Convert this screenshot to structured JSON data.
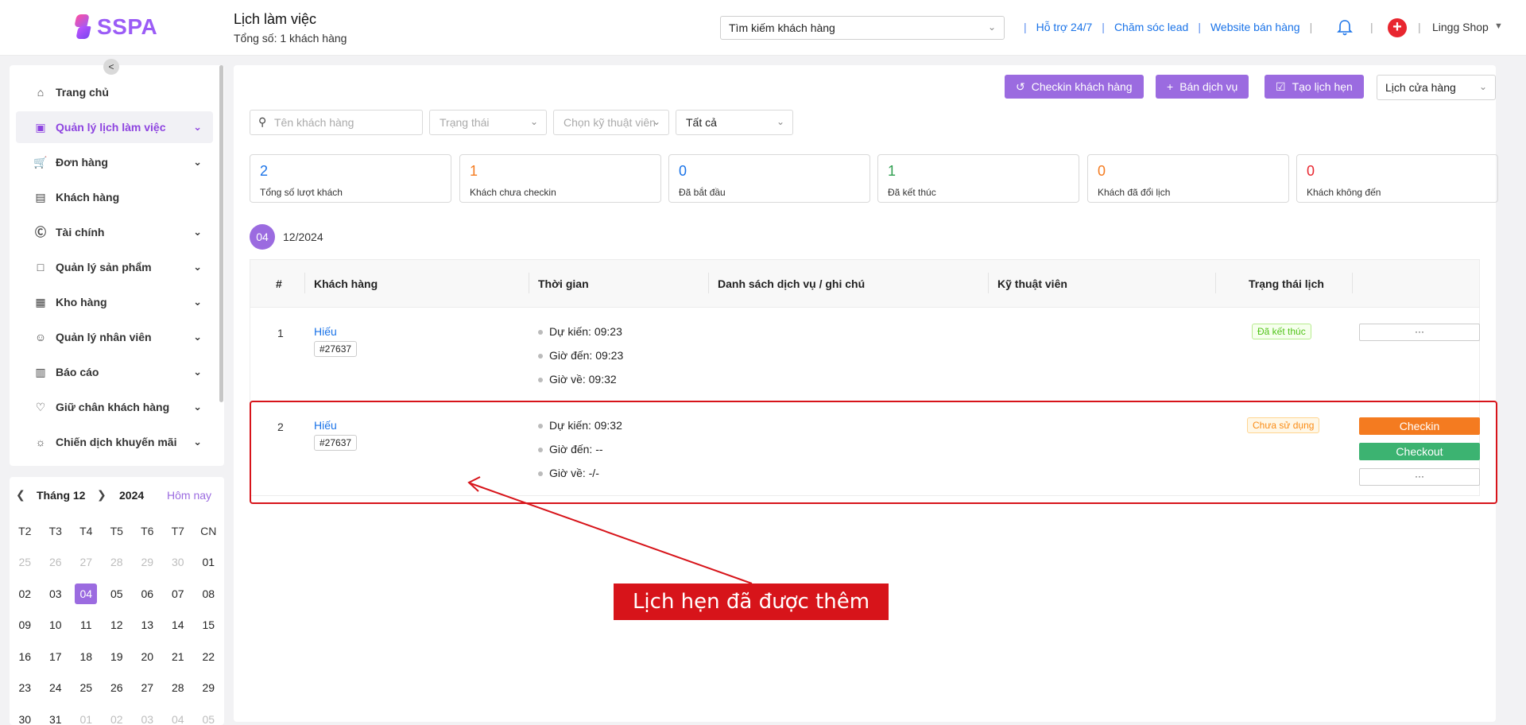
{
  "header": {
    "logo_text": "SSPA",
    "title": "Lịch làm việc",
    "subtitle": "Tổng số: 1 khách hàng",
    "search_placeholder": "Tìm kiếm khách hàng",
    "links": [
      "Hỗ trợ 24/7",
      "Chăm sóc lead",
      "Website bán hàng"
    ],
    "user_name": "Lingg Shop"
  },
  "sidebar": {
    "items": [
      {
        "label": "Trang chủ",
        "icon": "home-icon",
        "has_submenu": false
      },
      {
        "label": "Quản lý lịch làm việc",
        "icon": "calendar-icon",
        "has_submenu": true,
        "active": true
      },
      {
        "label": "Đơn hàng",
        "icon": "cart-icon",
        "has_submenu": true
      },
      {
        "label": "Khách hàng",
        "icon": "id-card-icon",
        "has_submenu": false
      },
      {
        "label": "Tài chính",
        "icon": "dollar-icon",
        "has_submenu": true
      },
      {
        "label": "Quản lý sản phẩm",
        "icon": "box-icon",
        "has_submenu": true
      },
      {
        "label": "Kho hàng",
        "icon": "warehouse-icon",
        "has_submenu": true
      },
      {
        "label": "Quản lý nhân viên",
        "icon": "users-icon",
        "has_submenu": true
      },
      {
        "label": "Báo cáo",
        "icon": "chart-icon",
        "has_submenu": true
      },
      {
        "label": "Giữ chân khách hàng",
        "icon": "heart-icon",
        "has_submenu": true
      },
      {
        "label": "Chiến dịch khuyến mãi",
        "icon": "promo-icon",
        "has_submenu": true
      }
    ]
  },
  "calendar": {
    "month_label": "Tháng 12",
    "year_label": "2024",
    "today_label": "Hôm nay",
    "weekdays": [
      "T2",
      "T3",
      "T4",
      "T5",
      "T6",
      "T7",
      "CN"
    ],
    "weeks": [
      [
        "25",
        "26",
        "27",
        "28",
        "29",
        "30",
        "01"
      ],
      [
        "02",
        "03",
        "04",
        "05",
        "06",
        "07",
        "08"
      ],
      [
        "09",
        "10",
        "11",
        "12",
        "13",
        "14",
        "15"
      ],
      [
        "16",
        "17",
        "18",
        "19",
        "20",
        "21",
        "22"
      ],
      [
        "23",
        "24",
        "25",
        "26",
        "27",
        "28",
        "29"
      ],
      [
        "30",
        "31",
        "01",
        "02",
        "03",
        "04",
        "05"
      ]
    ],
    "selected": "04"
  },
  "toolbar": {
    "checkin_customer": "Checkin khách hàng",
    "sell_service": "Bán dịch vụ",
    "create_appointment": "Tạo lịch hẹn",
    "store_select": "Lịch cửa hàng"
  },
  "filters": {
    "customer_placeholder": "Tên khách hàng",
    "status_placeholder": "Trạng thái",
    "technician_placeholder": "Chọn kỹ thuật viên",
    "all_label": "Tất cả"
  },
  "stats": [
    {
      "value": "2",
      "label": "Tổng số lượt khách",
      "color": "#1a73e8"
    },
    {
      "value": "1",
      "label": "Khách chưa checkin",
      "color": "#f47b20"
    },
    {
      "value": "0",
      "label": "Đã bắt đầu",
      "color": "#1a73e8"
    },
    {
      "value": "1",
      "label": "Đã kết thúc",
      "color": "#2e9e4f"
    },
    {
      "value": "0",
      "label": "Khách đã đổi lịch",
      "color": "#f47b20"
    },
    {
      "value": "0",
      "label": "Khách không đến",
      "color": "#e8262f"
    }
  ],
  "date_group": {
    "day": "04",
    "month_year": "12/2024"
  },
  "table": {
    "headers": [
      "#",
      "Khách hàng",
      "Thời gian",
      "Danh sách dịch vụ / ghi chú",
      "Kỹ thuật viên",
      "Trạng thái lịch"
    ],
    "rows": [
      {
        "index": "1",
        "customer": "Hiếu",
        "code": "#27637",
        "expected": "Dự kiến:  09:23",
        "arrived": "Giờ đến:  09:23",
        "left": "Giờ về:  09:32",
        "status": "Đã kết thúc",
        "more": "···"
      },
      {
        "index": "2",
        "customer": "Hiếu",
        "code": "#27637",
        "expected": "Dự kiến:  09:32",
        "arrived": "Giờ đến:  --",
        "left": "Giờ về:  -/-",
        "status": "Chưa sử dụng",
        "checkin": "Checkin",
        "checkout": "Checkout",
        "more": "···"
      }
    ]
  },
  "annotation": {
    "callout": "Lịch hẹn đã được thêm mới"
  }
}
